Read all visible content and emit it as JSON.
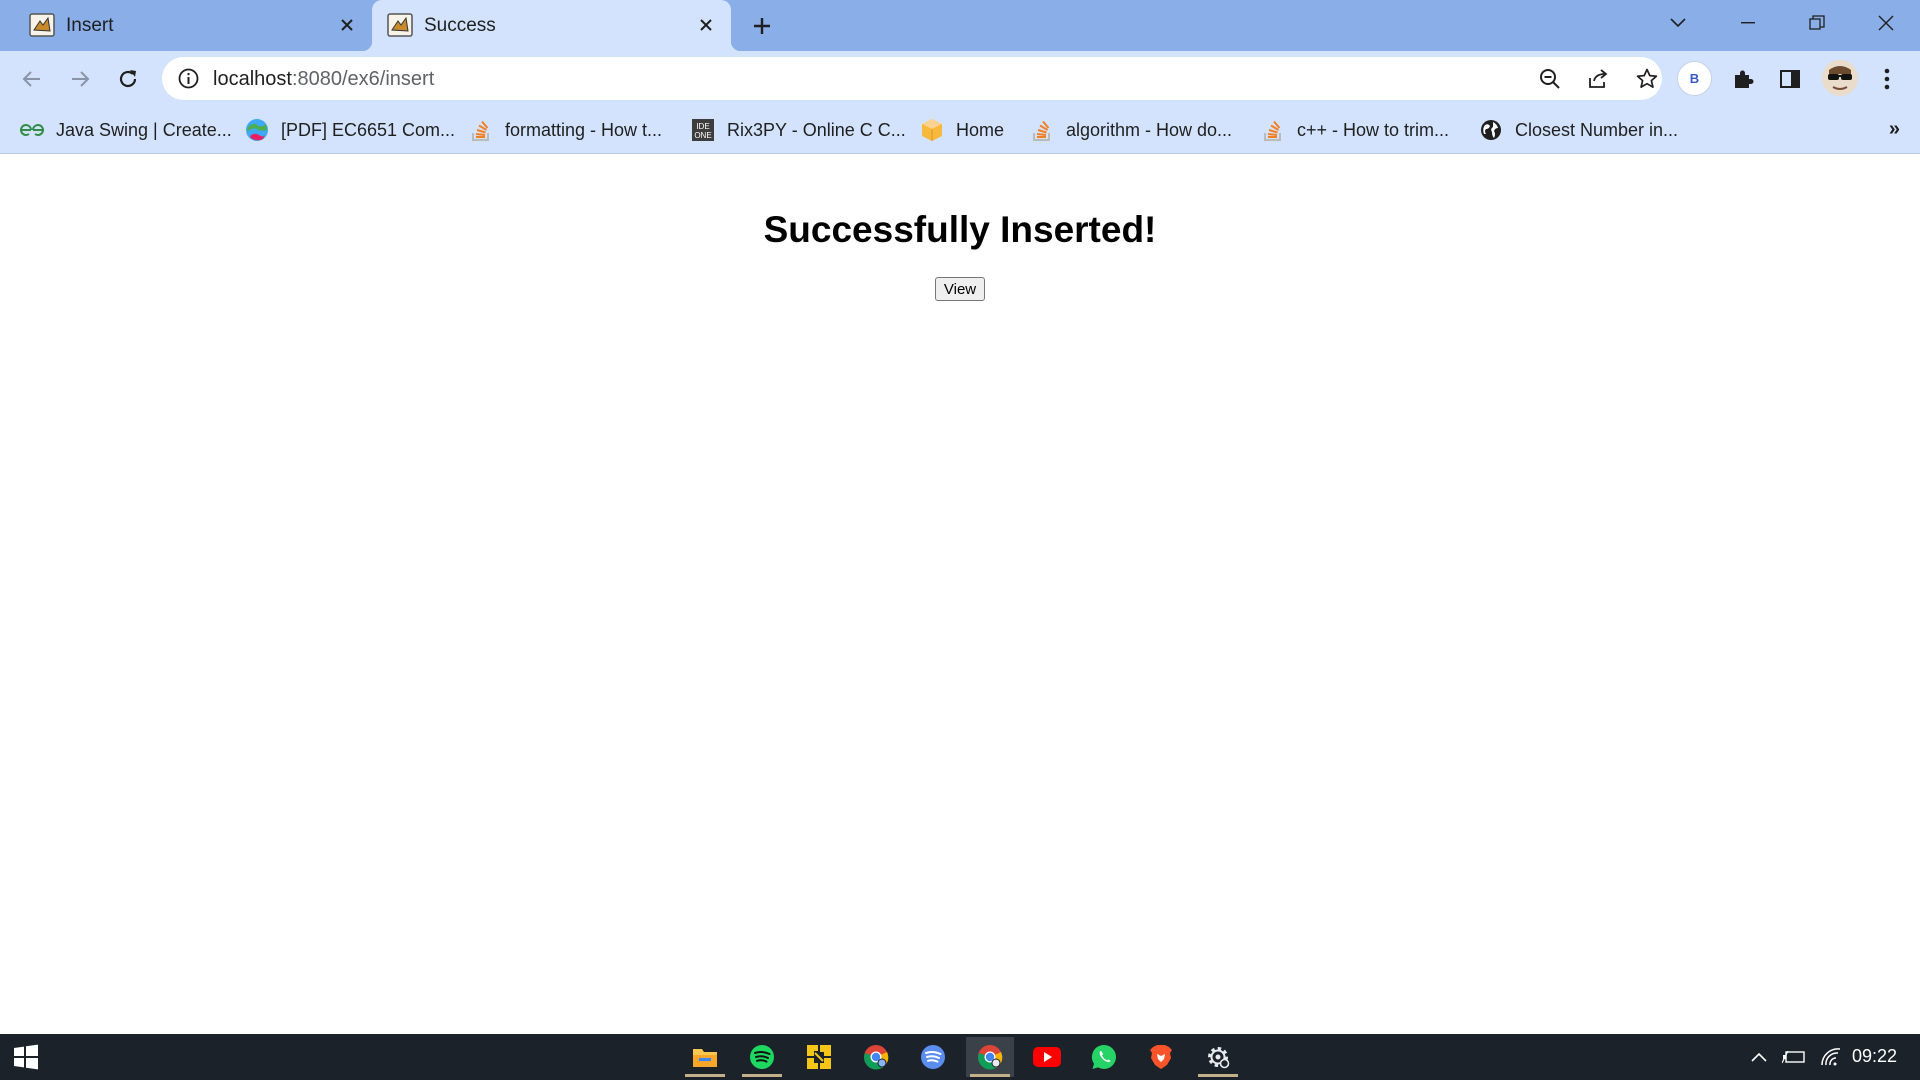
{
  "browser": {
    "tabs": [
      {
        "title": "Insert",
        "active": false
      },
      {
        "title": "Success",
        "active": true
      }
    ],
    "address": {
      "host": "localhost",
      "rest": ":8080/ex6/insert"
    },
    "profile_initial": "B",
    "bookmarks": [
      {
        "label": "Java Swing | Create...",
        "icon": "geeksforgeeks-icon"
      },
      {
        "label": "[PDF] EC6651 Com...",
        "icon": "globe-colorful-icon"
      },
      {
        "label": "formatting - How t...",
        "icon": "stackoverflow-icon"
      },
      {
        "label": "Rix3PY - Online C C...",
        "icon": "ideone-icon"
      },
      {
        "label": "Home",
        "icon": "cube-icon"
      },
      {
        "label": "algorithm - How do...",
        "icon": "stackoverflow-icon"
      },
      {
        "label": "c++ - How to trim...",
        "icon": "stackoverflow-icon"
      },
      {
        "label": "Closest Number in...",
        "icon": "globe-icon"
      }
    ],
    "bookmarks_more": "»"
  },
  "page": {
    "heading": "Successfully Inserted!",
    "view_button": "View"
  },
  "taskbar": {
    "apps": [
      "file-explorer-icon",
      "spotify-icon",
      "app-icon",
      "chrome-icon",
      "spotify-web-icon",
      "chrome-active-icon",
      "youtube-icon",
      "whatsapp-icon",
      "brave-icon",
      "settings-icon"
    ],
    "clock": "09:22"
  },
  "colors": {
    "tabstrip": "#8aaee8",
    "toolbar": "#d3e3fd",
    "taskbar": "#1b2229"
  }
}
